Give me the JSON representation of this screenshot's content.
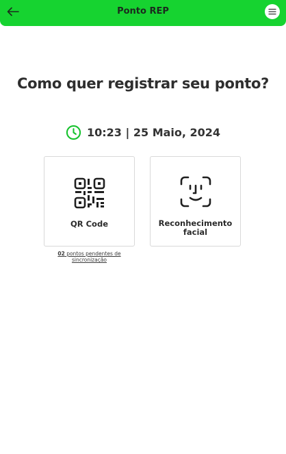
{
  "header": {
    "title": "Ponto REP",
    "back_icon": "arrow-left-icon",
    "menu_icon": "hamburger-menu-icon",
    "background_color": "#16d330"
  },
  "main": {
    "headline": "Como quer registrar seu ponto?",
    "datetime": {
      "icon": "clock-icon",
      "icon_color": "#16c22d",
      "text": "10:23 | 25 Maio, 2024"
    },
    "options": [
      {
        "label": "QR Code",
        "icon": "qr-code-icon"
      },
      {
        "label": "Reconhecimento facial",
        "icon": "face-scan-icon"
      }
    ],
    "pending": {
      "count": "02",
      "text": "pontos pendentes de sincronização"
    }
  }
}
